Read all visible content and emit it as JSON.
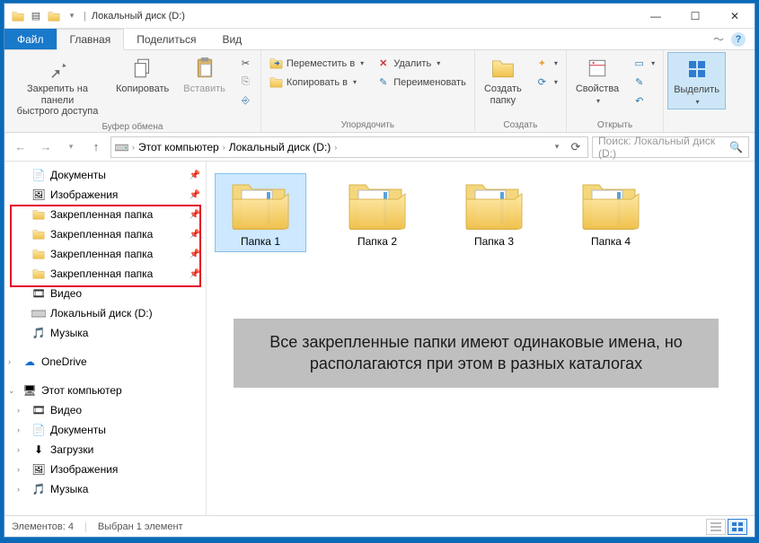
{
  "title": "Локальный диск (D:)",
  "tabs": {
    "file": "Файл",
    "home": "Главная",
    "share": "Поделиться",
    "view": "Вид"
  },
  "ribbon": {
    "clipboard": {
      "pin": "Закрепить на панели\nбыстрого доступа",
      "copy": "Копировать",
      "paste": "Вставить",
      "label": "Буфер обмена"
    },
    "organize": {
      "moveTo": "Переместить в",
      "copyTo": "Копировать в",
      "delete": "Удалить",
      "rename": "Переименовать",
      "label": "Упорядочить"
    },
    "new": {
      "newFolder": "Создать\nпапку",
      "label": "Создать"
    },
    "open": {
      "properties": "Свойства",
      "label": "Открыть"
    },
    "select": {
      "select": "Выделить",
      "label": ""
    }
  },
  "breadcrumbs": [
    "Этот компьютер",
    "Локальный диск (D:)"
  ],
  "search_placeholder": "Поиск: Локальный диск (D:)",
  "nav": {
    "documents": "Документы",
    "pictures": "Изображения",
    "pinned": [
      "Закрепленная папка",
      "Закрепленная папка",
      "Закрепленная папка",
      "Закрепленная папка"
    ],
    "video": "Видео",
    "localD": "Локальный диск (D:)",
    "music": "Музыка",
    "onedrive": "OneDrive",
    "thisPC": "Этот компьютер",
    "pcVideo": "Видео",
    "pcDocs": "Документы",
    "pcDown": "Загрузки",
    "pcPics": "Изображения",
    "pcMusic": "Музыка"
  },
  "folders": [
    "Папка 1",
    "Папка 2",
    "Папка 3",
    "Папка 4"
  ],
  "annotation": "Все закрепленные папки имеют одинаковые имена, но располагаются при этом в разных каталогах",
  "status": {
    "count": "Элементов: 4",
    "selected": "Выбран 1 элемент"
  }
}
